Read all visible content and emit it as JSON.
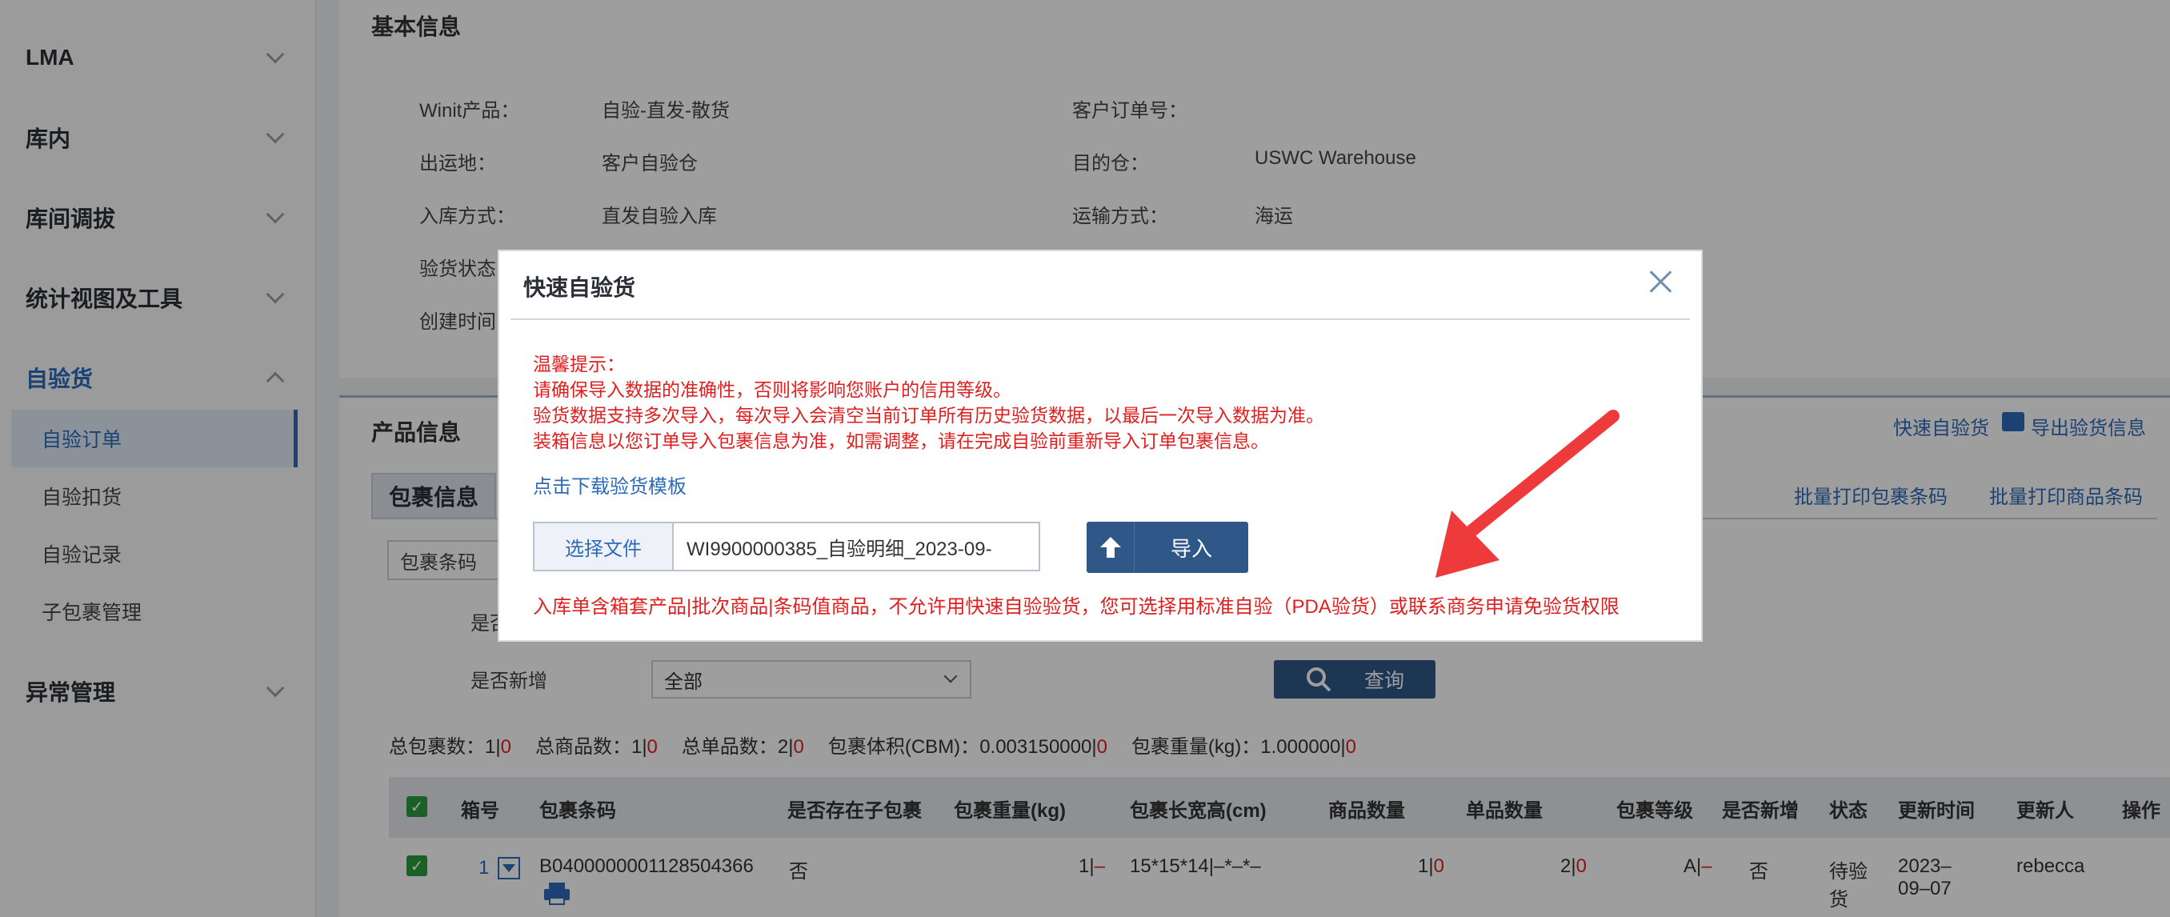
{
  "sidebar": {
    "groups": [
      {
        "label": "LMA"
      },
      {
        "label": "库内"
      },
      {
        "label": "库间调拔"
      },
      {
        "label": "统计视图及工具"
      },
      {
        "label": "自验货"
      },
      {
        "label": "异常管理"
      }
    ],
    "sub_items": [
      {
        "label": "自验订单"
      },
      {
        "label": "自验扣货"
      },
      {
        "label": "自验记录"
      },
      {
        "label": "子包裹管理"
      }
    ]
  },
  "basic_info": {
    "title": "基本信息",
    "product_label": "Winit产品：",
    "product_value": "自验-直发-散货",
    "customer_order_label": "客户订单号：",
    "origin_label": "出运地：",
    "origin_value": "客户自验仓",
    "dest_label": "目的仓：",
    "dest_value": "USWC Warehouse",
    "inbound_label": "入库方式：",
    "inbound_value": "直发自验入库",
    "transport_label": "运输方式：",
    "transport_value": "海运",
    "inspect_status_label": "验货状态",
    "created_label": "创建时间"
  },
  "product_info": {
    "title": "产品信息",
    "quick_inspect_link": "快速自验货",
    "export_link": "导出验货信息",
    "tab_label": "包裹信息",
    "batch_print_pkg": "批量打印包裹条码",
    "batch_print_item": "批量打印商品条码",
    "pkg_code_label": "包裹条码",
    "exists_label": "是否",
    "is_new_label": "是否新增",
    "is_new_value": "全部",
    "query_label": "查询"
  },
  "stats": {
    "total_pkg_label": "总包裹数：",
    "total_pkg": "1",
    "total_pkg_diff": "0",
    "total_goods_label": "总商品数：",
    "total_goods": "1",
    "total_goods_diff": "0",
    "total_units_label": "总单品数：",
    "total_units": "2",
    "total_units_diff": "0",
    "volume_label": "包裹体积(CBM)：",
    "volume": "0.003150000",
    "volume_diff": "0",
    "weight_label": "包裹重量(kg)：",
    "weight": "1.000000",
    "weight_diff": "0"
  },
  "table": {
    "headers": [
      "箱号",
      "包裹条码",
      "是否存在子包裹",
      "包裹重量(kg)",
      "包裹长宽高(cm)",
      "商品数量",
      "单品数量",
      "包裹等级",
      "是否新增",
      "状态",
      "更新时间",
      "更新人",
      "操作"
    ],
    "row": {
      "box_no": "1",
      "barcode": "B0400000001128504366",
      "has_child": "否",
      "weight": "1",
      "weight_diff": "–",
      "dims": "15*15*14|–*–*–",
      "goods_qty": "1",
      "goods_diff": "0",
      "unit_qty": "2",
      "unit_diff": "0",
      "grade": "A",
      "grade_diff": "–",
      "is_new": "否",
      "status_line1": "待验",
      "status_line2": "货",
      "update_line1": "2023–",
      "update_line2": "09–07",
      "updater": "rebecca"
    }
  },
  "modal": {
    "title": "快速自验货",
    "tip_title": "温馨提示：",
    "tip_1": "请确保导入数据的准确性，否则将影响您账户的信用等级。",
    "tip_2": "验货数据支持多次导入，每次导入会清空当前订单所有历史验货数据，以最后一次导入数据为准。",
    "tip_3": "装箱信息以您订单导入包裹信息为准，如需调整，请在完成自验前重新导入订单包裹信息。",
    "download_link": "点击下载验货模板",
    "choose_file": "选择文件",
    "file_name": "WI9900000385_自验明细_2023-09-",
    "import_label": "导入",
    "error_msg": "入库单含箱套产品|批次商品|条码值商品，不允许用快速自验验货，您可选择用标准自验（PDA验货）或联系商务申请免验货权限"
  },
  "colors": {
    "accent": "#2d6bb8",
    "primary_button": "#2f5888",
    "warning": "#e02020",
    "arrow": "#ee3a3a"
  }
}
